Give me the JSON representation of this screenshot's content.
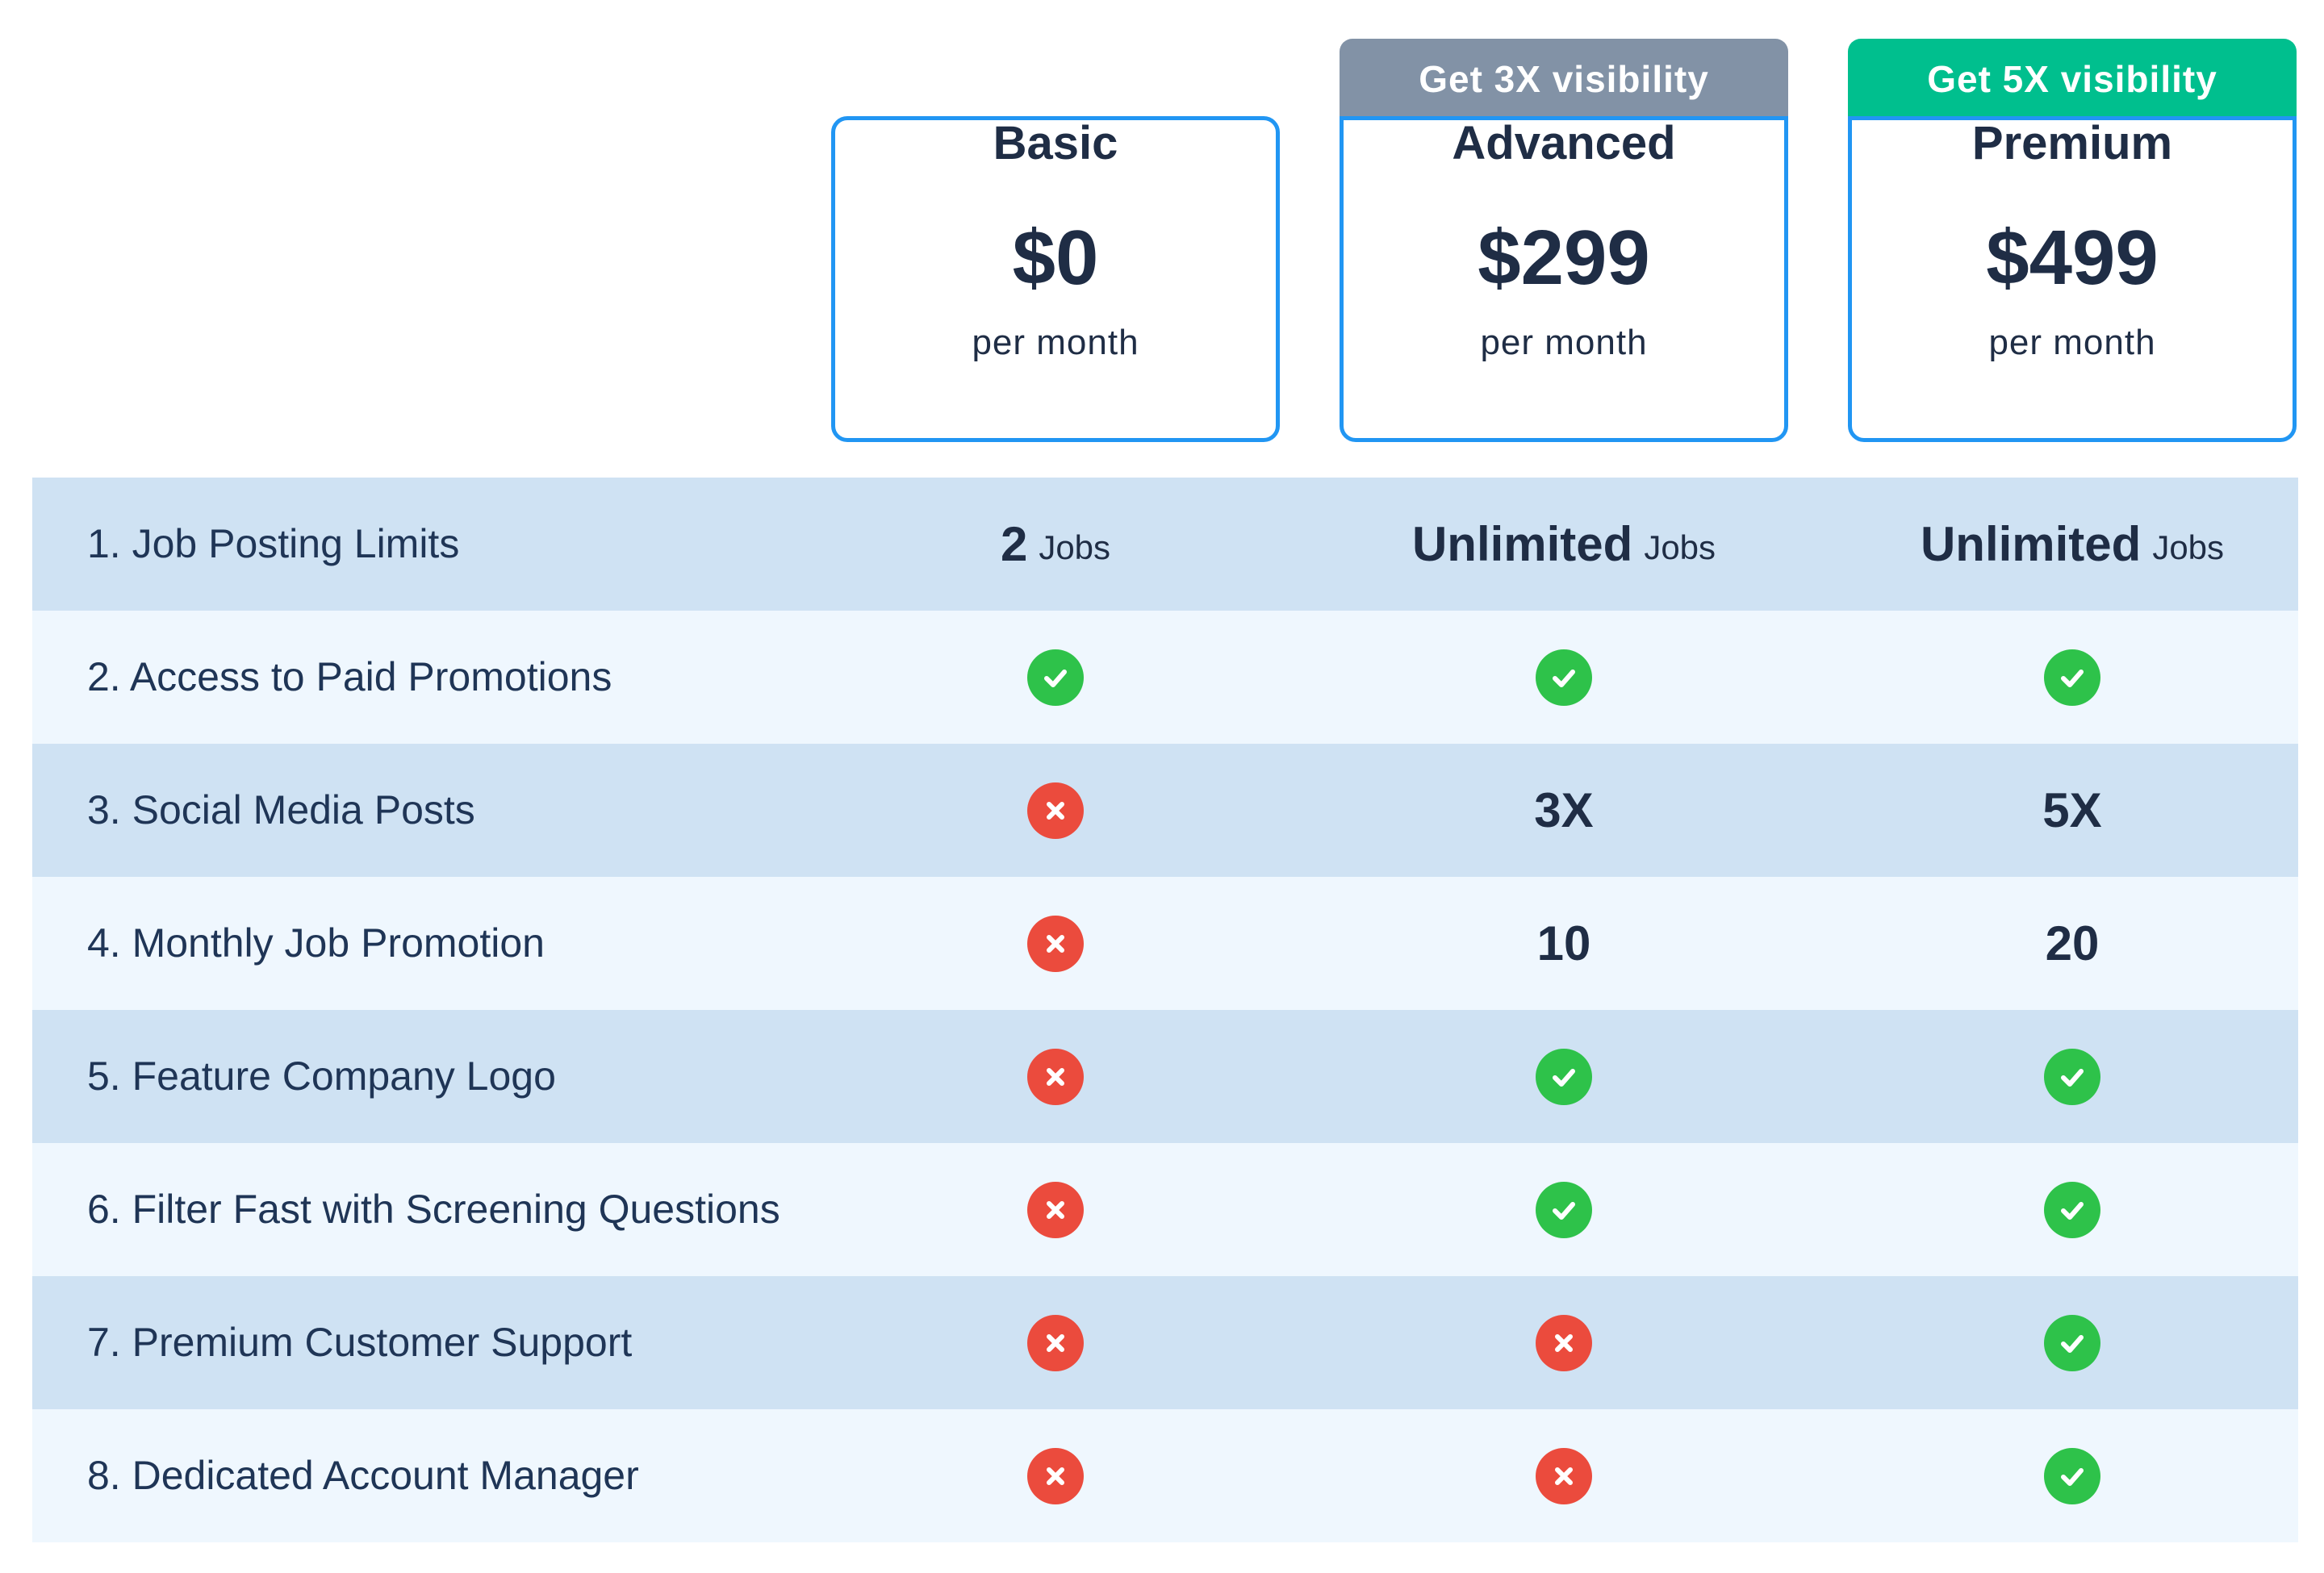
{
  "colors": {
    "card_border": "#2196f3",
    "badge_advanced": "#8292a6",
    "badge_premium": "#00bf8e",
    "row_dark": "#cfe2f3",
    "row_light": "#eff7fe",
    "check": "#2ec24a",
    "cross": "#eb4b3d",
    "text": "#1f2d45"
  },
  "plans": [
    {
      "badge": "",
      "name": "Basic",
      "price": "$0",
      "period": "per month"
    },
    {
      "badge": "Get 3X visibility",
      "name": "Advanced",
      "price": "$299",
      "period": "per month",
      "badge_color": "#8292a6"
    },
    {
      "badge": "Get 5X visibility",
      "name": "Premium",
      "price": "$499",
      "period": "per month",
      "badge_color": "#00bf8e"
    }
  ],
  "features": [
    {
      "label": "1. Job Posting Limits",
      "values": [
        {
          "type": "amount",
          "main": "2",
          "unit": "Jobs"
        },
        {
          "type": "amount",
          "main": "Unlimited",
          "unit": "Jobs"
        },
        {
          "type": "amount",
          "main": "Unlimited",
          "unit": "Jobs"
        }
      ]
    },
    {
      "label": "2. Access to Paid Promotions",
      "values": [
        {
          "type": "check",
          "icon": "check-icon"
        },
        {
          "type": "check",
          "icon": "check-icon"
        },
        {
          "type": "check",
          "icon": "check-icon"
        }
      ]
    },
    {
      "label": "3. Social Media Posts",
      "values": [
        {
          "type": "cross",
          "icon": "cross-icon"
        },
        {
          "type": "text",
          "text": "3X"
        },
        {
          "type": "text",
          "text": "5X"
        }
      ]
    },
    {
      "label": "4. Monthly Job Promotion",
      "values": [
        {
          "type": "cross",
          "icon": "cross-icon"
        },
        {
          "type": "text",
          "text": "10"
        },
        {
          "type": "text",
          "text": "20"
        }
      ]
    },
    {
      "label": "5. Feature Company Logo",
      "values": [
        {
          "type": "cross",
          "icon": "cross-icon"
        },
        {
          "type": "check",
          "icon": "check-icon"
        },
        {
          "type": "check",
          "icon": "check-icon"
        }
      ]
    },
    {
      "label": "6. Filter Fast with Screening Questions",
      "values": [
        {
          "type": "cross",
          "icon": "cross-icon"
        },
        {
          "type": "check",
          "icon": "check-icon"
        },
        {
          "type": "check",
          "icon": "check-icon"
        }
      ]
    },
    {
      "label": "7. Premium Customer Support",
      "values": [
        {
          "type": "cross",
          "icon": "cross-icon"
        },
        {
          "type": "cross",
          "icon": "cross-icon"
        },
        {
          "type": "check",
          "icon": "check-icon"
        }
      ]
    },
    {
      "label": "8. Dedicated Account Manager",
      "values": [
        {
          "type": "cross",
          "icon": "cross-icon"
        },
        {
          "type": "cross",
          "icon": "cross-icon"
        },
        {
          "type": "check",
          "icon": "check-icon"
        }
      ]
    }
  ]
}
